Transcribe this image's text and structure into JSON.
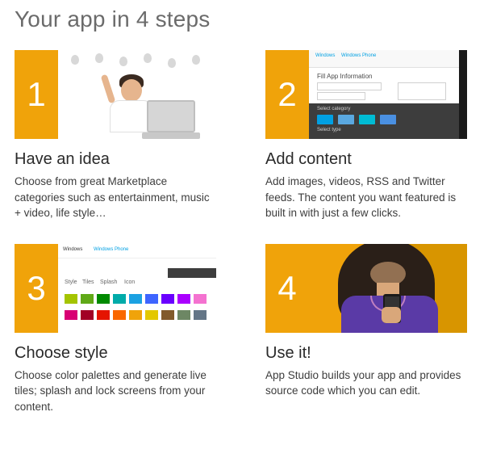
{
  "title": "Your app in 4 steps",
  "colors": {
    "accent": "#f0a30a",
    "link": "#00a0e3"
  },
  "thumb2": {
    "heading": "Fill App Information",
    "section1": "Select category",
    "section2": "Select type",
    "topLinks": [
      "Windows",
      "Windows Phone"
    ]
  },
  "thumb3": {
    "brand1": "Windows",
    "brand2": "Windows Phone",
    "tabs": [
      "Style",
      "Tiles",
      "Splash",
      "Icon"
    ]
  },
  "steps": [
    {
      "number": "1",
      "title": "Have an idea",
      "description": "Choose from great Marketplace categories such as entertainment, music + video, life style…"
    },
    {
      "number": "2",
      "title": "Add content",
      "description": "Add images, videos, RSS and Twitter feeds. The content you want featured is built in with just a few clicks."
    },
    {
      "number": "3",
      "title": "Choose style",
      "description": "Choose color palettes and generate live tiles; splash and lock screens from your content."
    },
    {
      "number": "4",
      "title": "Use it!",
      "description": "App Studio builds your app and provides source code which you can edit."
    }
  ]
}
